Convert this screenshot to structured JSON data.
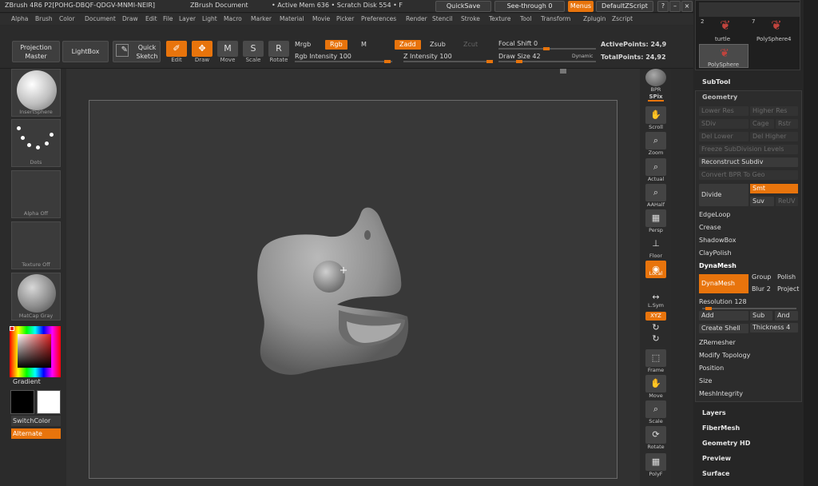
{
  "title_bar": {
    "app": "ZBrush 4R6 P2[POHG-DBQF-QDGV-MNMI-NEIR]",
    "doc": "ZBrush Document",
    "mem": "• Active Mem 636  • Scratch Disk 554  • F",
    "quicksave": "QuickSave",
    "seethrough": "See-through  0",
    "menus": "Menus",
    "zscript": "DefaultZScript"
  },
  "menu": [
    "Alpha",
    "Brush",
    "Color",
    "Document",
    "Draw",
    "Edit",
    "File",
    "Layer",
    "Light",
    "Macro",
    "Marker",
    "Material",
    "Movie",
    "Picker",
    "Preferences",
    "Render",
    "Stencil",
    "Stroke",
    "Texture",
    "Tool",
    "Transform",
    "Zplugin",
    "Zscript"
  ],
  "toolbar": {
    "projection_master": "Projection Master",
    "lightbox": "LightBox",
    "quick_sketch": "Quick Sketch",
    "edit": "Edit",
    "draw": "Draw",
    "move": "Move",
    "scale": "Scale",
    "rotate": "Rotate",
    "mrgb": "Mrgb",
    "rgb": "Rgb",
    "m": "M",
    "zadd": "Zadd",
    "zsub": "Zsub",
    "zcut": "Zcut",
    "rgb_intensity": "Rgb Intensity 100",
    "z_intensity": "Z Intensity 100",
    "focal_shift": "Focal Shift 0",
    "draw_size": "Draw Size 42",
    "dynamic": "Dynamic",
    "active_points": "ActivePoints: 24,9",
    "total_points": "TotalPoints: 24,92"
  },
  "left_shelf": {
    "brush": "InsertSphere",
    "stroke": "Dots",
    "alpha": "Alpha Off",
    "texture": "Texture Off",
    "material": "MatCap Gray",
    "gradient": "Gradient",
    "switch_color": "SwitchColor",
    "alternate": "Alternate"
  },
  "right_shelf": [
    "BPR",
    "SPix",
    "Scroll",
    "Zoom",
    "Actual",
    "AAHalf",
    "Persp",
    "Floor",
    "Local",
    "L.Sym",
    "XYZ",
    "Frame",
    "Move",
    "Scale",
    "Rotate",
    "PolyF"
  ],
  "panel": {
    "thumbs": {
      "t2": "2",
      "t7": "7",
      "turtle": "turtle",
      "polysphere4": "PolySphere4",
      "polysphere": "PolySphere"
    },
    "subtool": "SubTool",
    "geometry": "Geometry",
    "lower_res": "Lower Res",
    "higher_res": "Higher Res",
    "sdiv": "SDiv",
    "cage": "Cage",
    "rstr": "Rstr",
    "del_lower": "Del Lower",
    "del_higher": "Del Higher",
    "freeze": "Freeze SubDivision Levels",
    "reconstruct": "Reconstruct Subdiv",
    "convert_bpr": "Convert BPR To Geo",
    "divide": "Divide",
    "smt": "Smt",
    "suv": "Suv",
    "reuv": "ReUV",
    "edgeloop": "EdgeLoop",
    "crease": "Crease",
    "shadowbox": "ShadowBox",
    "claypolish": "ClayPolish",
    "dynamesh_header": "DynaMesh",
    "dynamesh": "DynaMesh",
    "group": "Group",
    "polish": "Polish",
    "blur": "Blur 2",
    "project": "Project",
    "resolution": "Resolution 128",
    "add": "Add",
    "sub": "Sub",
    "and": "And",
    "create_shell": "Create Shell",
    "thickness": "Thickness 4",
    "zremesher": "ZRemesher",
    "modify_topology": "Modify Topology",
    "position": "Position",
    "size": "Size",
    "meshintegrity": "MeshIntegrity",
    "layers": "Layers",
    "fibermesh": "FiberMesh",
    "geometry_hd": "Geometry HD",
    "preview": "Preview",
    "surface": "Surface"
  }
}
